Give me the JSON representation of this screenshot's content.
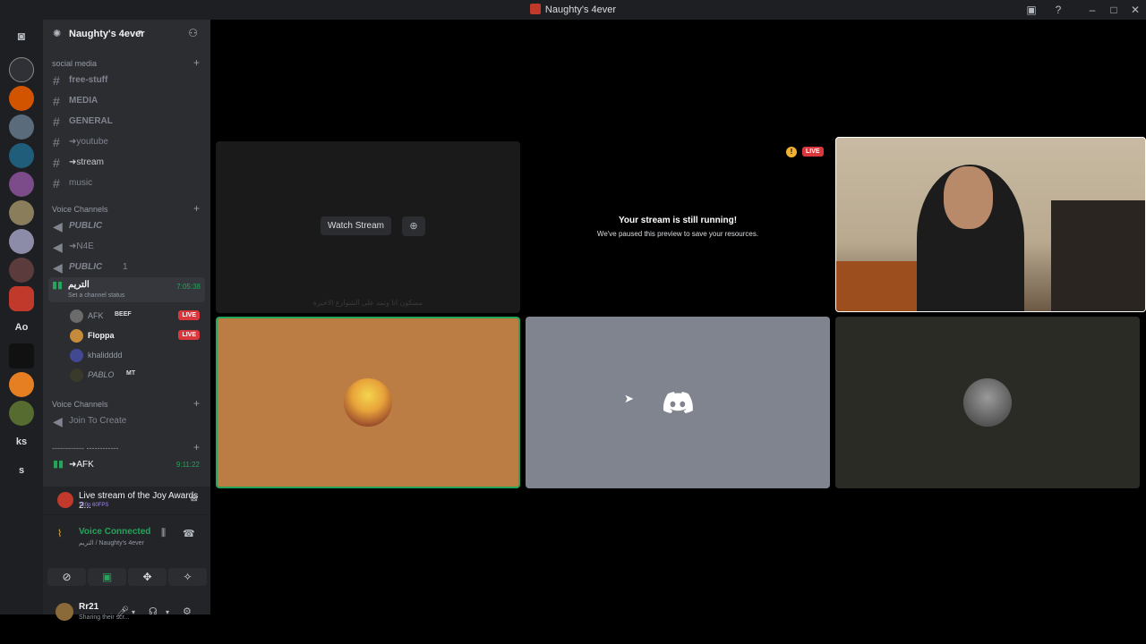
{
  "window": {
    "title": "Naughty's 4ever"
  },
  "server": {
    "name": "Naughty's 4ever"
  },
  "guild_rail": {
    "labels": [
      "Ao",
      "ks",
      "s"
    ]
  },
  "channels": {
    "cat_social": "social media",
    "text": [
      "free-stuff",
      "MEDIA",
      "GENERAL",
      "➜youtube",
      "➜stream",
      "music"
    ],
    "cat_voice1": "Voice Channels",
    "voice": [
      "PUBLIC",
      "➜N4E",
      "PUBLIC"
    ],
    "voice3_count": "1",
    "active": {
      "name": "التريم",
      "status": "Set a channel status",
      "time": "7:05:38"
    },
    "users": [
      {
        "name": "AFK",
        "badge": "BEEF",
        "live": "LIVE"
      },
      {
        "name": "Floppa",
        "live": "LIVE"
      },
      {
        "name": "khalidddd"
      },
      {
        "name": "PABLO",
        "badge": "MT"
      }
    ],
    "cat_voice2": "Voice Channels",
    "join": "Join To Create",
    "cat_sep": "------------ ------------",
    "afk": {
      "name": "➜AFK",
      "time": "9:11:22"
    }
  },
  "panel": {
    "stream_title": "Live stream of the Joy Awards 2...",
    "stream_quality": "720p 60FPS",
    "voice_status": "Voice Connected",
    "voice_sub": "التريم / Naughty's 4ever",
    "user_name": "Rr21",
    "user_status": "Sharing their scr..."
  },
  "stage": {
    "watch_stream": "Watch Stream",
    "tile1_caption": "مسكون انا وتمد على الشوارع الاخيرة",
    "still_running": "Your stream is still running!",
    "paused_msg": "We've paused this preview to save your resources.",
    "live_badge": "LIVE",
    "warn_glyph": "!"
  }
}
